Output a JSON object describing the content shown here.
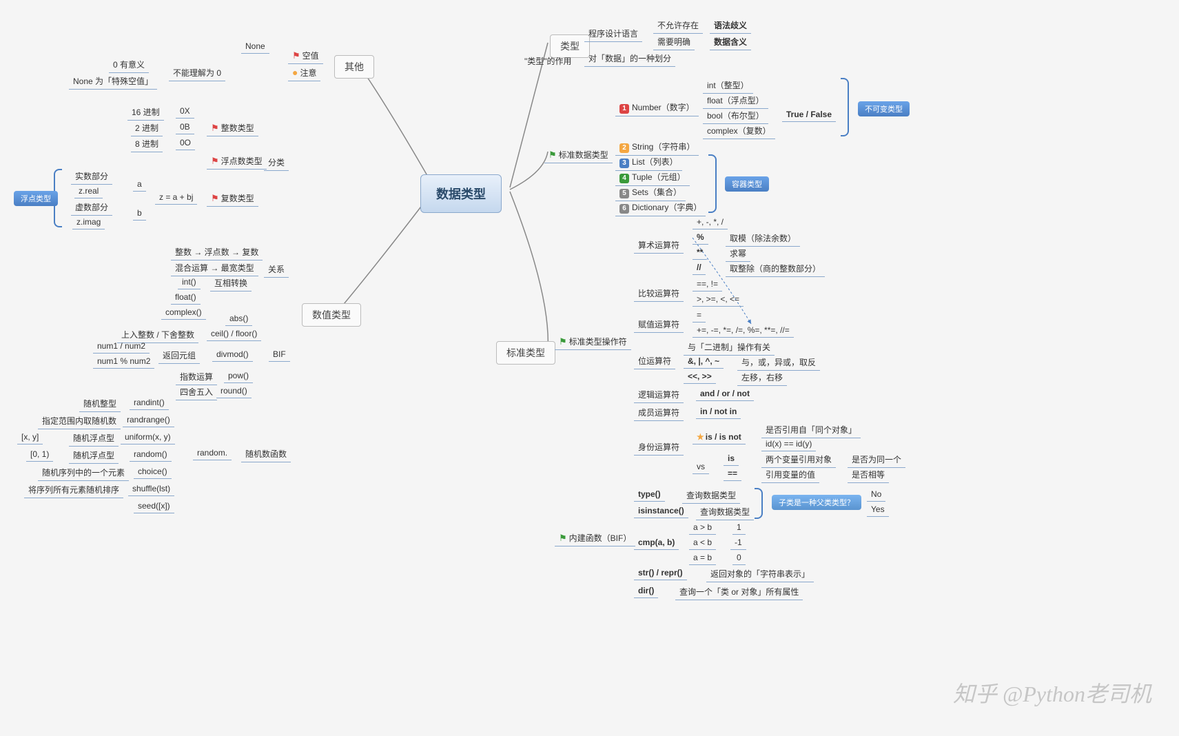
{
  "root": "数据类型",
  "left": {
    "other": {
      "label": "其他",
      "empty": "空值",
      "none": "None",
      "attention": "注意",
      "not0": "不能理解为 0",
      "zero_meaning": "0 有意义",
      "none_special": "None 为「特殊空值」"
    },
    "numeric": {
      "label": "数值类型",
      "classify": "分类",
      "int_type": "整数类型",
      "hex": "0X",
      "hex_l": "16 进制",
      "bin": "0B",
      "bin_l": "2 进制",
      "oct": "0O",
      "oct_l": "8 进制",
      "float_type": "浮点数类型",
      "complex_type": "复数类型",
      "complex_expr": "z = a + bj",
      "a": "a",
      "b": "b",
      "real_part": "实数部分",
      "zreal": "z.real",
      "imag_part": "虚数部分",
      "zimag": "z.imag",
      "float_tag": "浮点类型",
      "relation": "关系",
      "rel1": "整数 → 浮点数 → 复数",
      "rel2": "混合运算 → 最宽类型",
      "convert": "互相转换",
      "int_fn": "int()",
      "float_fn": "float()",
      "complex_fn": "complex()",
      "bif": "BIF",
      "abs": "abs()",
      "ceil_floor": "ceil() / floor()",
      "ceil_l": "上入整数 / 下舍整数",
      "divmod": "divmod()",
      "divmod_l": "返回元组",
      "divmod_n1": "num1 / num2",
      "divmod_n2": "num1 % num2",
      "pow": "pow()",
      "pow_l": "指数运算",
      "round": "round()",
      "round_l": "四舍五入",
      "random": "随机数函数",
      "random_mod": "random.",
      "randint": "randint()",
      "randint_l": "随机整型",
      "randrange": "randrange()",
      "randrange_l": "指定范围内取随机数",
      "uniform": "uniform(x, y)",
      "uniform_l": "随机浮点型",
      "uniform_r": "[x, y]",
      "random_fn": "random()",
      "random_fn_l": "随机浮点型",
      "random_fn_r": "[0, 1)",
      "choice": "choice()",
      "choice_l": "随机序列中的一个元素",
      "shuffle": "shuffle(lst)",
      "shuffle_l": "将序列所有元素随机排序",
      "seed": "seed([x])"
    }
  },
  "right": {
    "type": {
      "label": "类型",
      "role": "\"类型\"的作用",
      "lang": "程序设计语言",
      "no_ambig": "不允许存在",
      "no_ambig2": "语法歧义",
      "need_clear": "需要明确",
      "need_clear2": "数据含义",
      "division": "对「数据」的一种划分"
    },
    "std_data": {
      "label": "标准数据类型",
      "number": "Number（数字）",
      "int": "int（整型）",
      "float": "float（浮点型）",
      "bool": "bool（布尔型）",
      "truefalse": "True / False",
      "complex": "complex（复数）",
      "string": "String（字符串）",
      "list": "List（列表）",
      "tuple": "Tuple（元组）",
      "sets": "Sets（集合）",
      "dict": "Dictionary（字典）",
      "immutable": "不可变类型",
      "container": "容器类型"
    },
    "std_type": {
      "label": "标准类型",
      "ops": "标准类型操作符",
      "arith": "算术运算符",
      "arith1": "+, -, *, /",
      "arith2": "%",
      "arith2_l": "取模（除法余数）",
      "arith3": "**",
      "arith3_l": "求幂",
      "arith4": "//",
      "arith4_l": "取整除（商的整数部分）",
      "cmp": "比较运算符",
      "cmp1": "==, !=",
      "cmp2": ">, >=, <, <=",
      "assign": "赋值运算符",
      "assign1": "=",
      "assign2": "+=, -=, *=, /=, %=, **=, //=",
      "bit": "位运算符",
      "bit_note": "与「二进制」操作有关",
      "bit1": "&, |, ^, ~",
      "bit1_l": "与，或，异或，取反",
      "bit2": "<<, >>",
      "bit2_l": "左移，右移",
      "logic": "逻辑运算符",
      "logic1": "and / or / not",
      "member": "成员运算符",
      "member1": "in / not in",
      "identity": "身份运算符",
      "identity1": "is / is not",
      "id_ref": "是否引用自「同个对象」",
      "id_eq": "id(x) == id(y)",
      "vs": "vs",
      "is_op": "is",
      "is_l": "两个变量引用对象",
      "is_r": "是否为同一个",
      "eq_op": "==",
      "eq_l": "引用变量的值",
      "eq_r": "是否相等",
      "bif": "内建函数（BIF）",
      "type_fn": "type()",
      "type_l": "查询数据类型",
      "isinstance": "isinstance()",
      "isinstance_l": "查询数据类型",
      "subclass_q": "子类是一种父类类型？",
      "no": "No",
      "yes": "Yes",
      "cmp_fn": "cmp(a, b)",
      "agtb": "a > b",
      "agtb_v": "1",
      "altb": "a < b",
      "altb_v": "-1",
      "aeqb": "a = b",
      "aeqb_v": "0",
      "str_repr": "str() / repr()",
      "str_repr_l": "返回对象的「字符串表示」",
      "dir": "dir()",
      "dir_l": "查询一个「类 or 对象」所有属性"
    }
  },
  "watermark": "知乎 @Python老司机"
}
